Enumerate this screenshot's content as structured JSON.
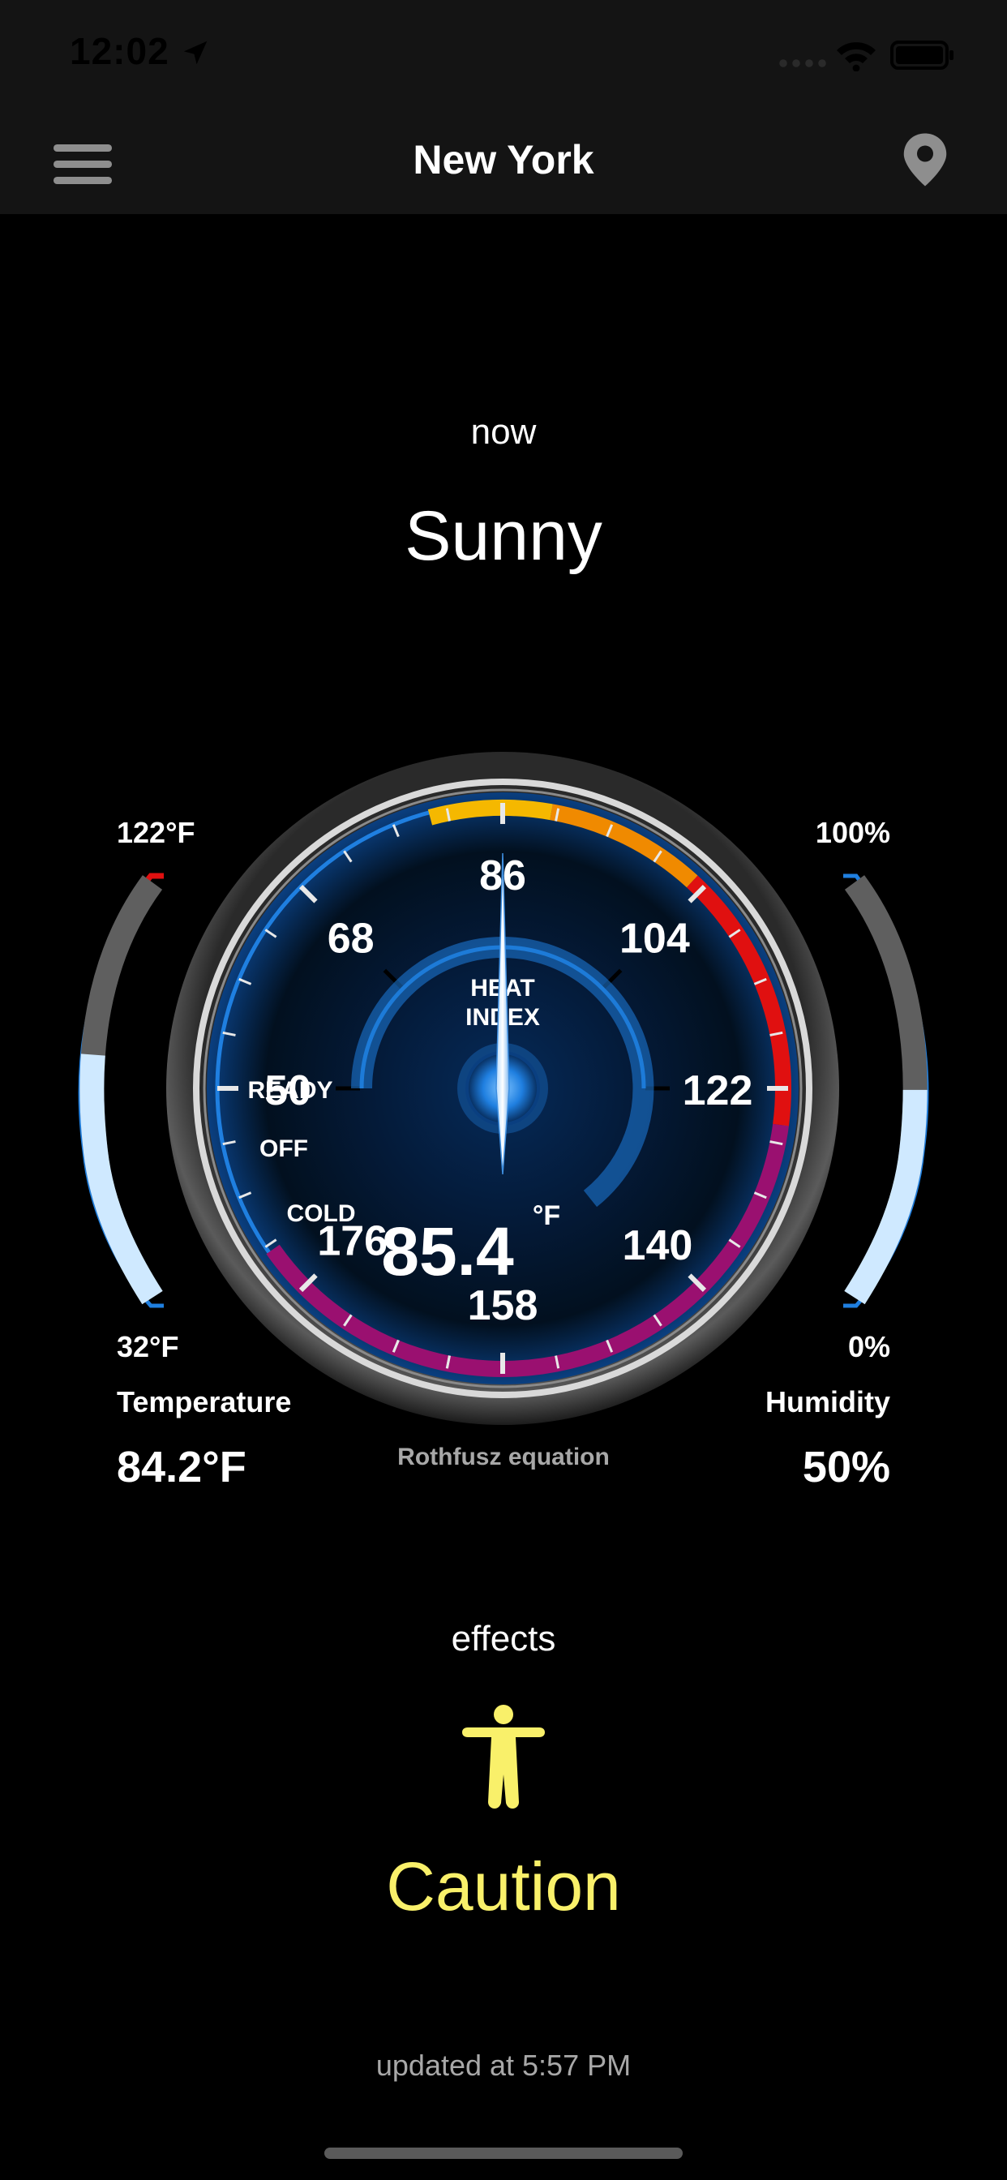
{
  "status_bar": {
    "time": "12:02"
  },
  "nav": {
    "title": "New York"
  },
  "current": {
    "label": "now",
    "condition": "Sunny"
  },
  "gauge": {
    "title_line1": "HEAT",
    "title_line2": "INDEX",
    "value": "85.4",
    "unit": "°F",
    "needle_value": 86,
    "ticks": [
      "50",
      "68",
      "86",
      "104",
      "122",
      "140",
      "158",
      "176"
    ],
    "zones": [
      "READY",
      "OFF",
      "COLD"
    ],
    "colors": {
      "caution": "#f5b800",
      "extreme_caution": "#f08a00",
      "danger": "#e01010",
      "extreme_danger": "#9a1070",
      "blue": "#1f7fe0"
    },
    "equation": "Rothfusz equation"
  },
  "temperature": {
    "max_label": "122°F",
    "min_label": "32°F",
    "title": "Temperature",
    "value": "84.2°F",
    "fill_fraction": 0.58
  },
  "humidity": {
    "max_label": "100%",
    "min_label": "0%",
    "title": "Humidity",
    "value": "50%",
    "fill_fraction": 0.5
  },
  "effects": {
    "label": "effects",
    "icon": "person-icon",
    "level": "Caution",
    "level_color": "#f9f06a"
  },
  "updated": "updated at 5:57 PM"
}
